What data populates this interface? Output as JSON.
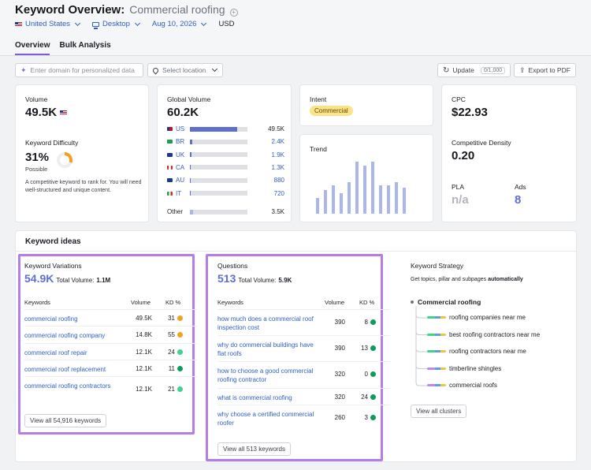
{
  "header": {
    "title": "Keyword Overview:",
    "keyword": "Commercial roofing",
    "country": "United States",
    "device": "Desktop",
    "date": "Aug 10, 2026",
    "currency": "USD",
    "tabs": [
      "Overview",
      "Bulk Analysis"
    ],
    "active_tab": "Overview"
  },
  "toolbar": {
    "domain_placeholder": "Enter domain for personalized data",
    "location_placeholder": "Select location",
    "update_label": "Update",
    "update_counter": "0/1,000",
    "export_label": "Export to PDF"
  },
  "volume": {
    "label": "Volume",
    "value": "49.5K"
  },
  "difficulty": {
    "label": "Keyword Difficulty",
    "value": "31%",
    "status": "Possible",
    "percent": 31,
    "description": "A competitive keyword to rank for. You will need well-structured and unique content."
  },
  "global_volume": {
    "label": "Global Volume",
    "value": "60.2K",
    "countries": [
      {
        "code": "US",
        "value": "49.5K",
        "share": 0.82
      },
      {
        "code": "BR",
        "value": "2.4K",
        "share": 0.04
      },
      {
        "code": "UK",
        "value": "1.9K",
        "share": 0.03
      },
      {
        "code": "CA",
        "value": "1.3K",
        "share": 0.02
      },
      {
        "code": "AU",
        "value": "880",
        "share": 0.015
      },
      {
        "code": "IT",
        "value": "720",
        "share": 0.012
      }
    ],
    "other_label": "Other",
    "other_value": "3.5K",
    "other_share": 0.06
  },
  "intent": {
    "label": "Intent",
    "value": "Commercial"
  },
  "trend": {
    "label": "Trend",
    "values": [
      0.3,
      0.45,
      0.55,
      0.4,
      0.6,
      1.0,
      0.92,
      1.0,
      0.55,
      0.55,
      0.6,
      0.5
    ]
  },
  "cpc": {
    "label": "CPC",
    "value": "$22.93"
  },
  "competitive_density": {
    "label": "Competitive Density",
    "value": "0.20"
  },
  "pla": {
    "label": "PLA",
    "value": "n/a"
  },
  "ads": {
    "label": "Ads",
    "value": "8"
  },
  "ideas": {
    "title": "Keyword ideas",
    "variations": {
      "title": "Keyword Variations",
      "count": "54.9K",
      "total_label": "Total Volume:",
      "total_value": "1.1M",
      "columns": [
        "Keywords",
        "Volume",
        "KD %"
      ],
      "rows": [
        {
          "kw": "commercial roofing",
          "vol": "49.5K",
          "kd": "31",
          "color": "#f0a321"
        },
        {
          "kw": "commercial roofing company",
          "vol": "14.8K",
          "kd": "55",
          "color": "#f0a321"
        },
        {
          "kw": "commercial roof repair",
          "vol": "12.1K",
          "kd": "24",
          "color": "#3fd38b"
        },
        {
          "kw": "commercial roof replacement",
          "vol": "12.1K",
          "kd": "11",
          "color": "#119b5b"
        },
        {
          "kw": "commercial roofing contractors",
          "vol": "12.1K",
          "kd": "21",
          "color": "#3fd38b"
        }
      ],
      "view_all": "View all 54,916 keywords"
    },
    "questions": {
      "title": "Questions",
      "count": "513",
      "total_label": "Total Volume:",
      "total_value": "5.9K",
      "columns": [
        "Keywords",
        "Volume",
        "KD %"
      ],
      "rows": [
        {
          "kw": "how much does a commercial roof inspection cost",
          "vol": "390",
          "kd": "8",
          "color": "#119b5b"
        },
        {
          "kw": "why do commercial buildings have flat roofs",
          "vol": "390",
          "kd": "13",
          "color": "#119b5b"
        },
        {
          "kw": "how to choose a good commercial roofing contractor",
          "vol": "320",
          "kd": "0",
          "color": "#119b5b"
        },
        {
          "kw": "what is commercial roofing",
          "vol": "320",
          "kd": "24",
          "color": "#119b5b"
        },
        {
          "kw": "why choose a certified commercial roofer",
          "vol": "260",
          "kd": "3",
          "color": "#119b5b"
        }
      ],
      "view_all": "View all 513 keywords"
    },
    "strategy": {
      "title": "Keyword Strategy",
      "subtitle": "Get topics, pillar and subpages",
      "subtitle_bold": "automatically",
      "root": "Commercial roofing",
      "items": [
        "roofing companies near me",
        "best roofing contractors near me",
        "roofing contractors near me",
        "timberline shingles",
        "commercial roofs"
      ],
      "view_all": "View all clusters"
    }
  }
}
